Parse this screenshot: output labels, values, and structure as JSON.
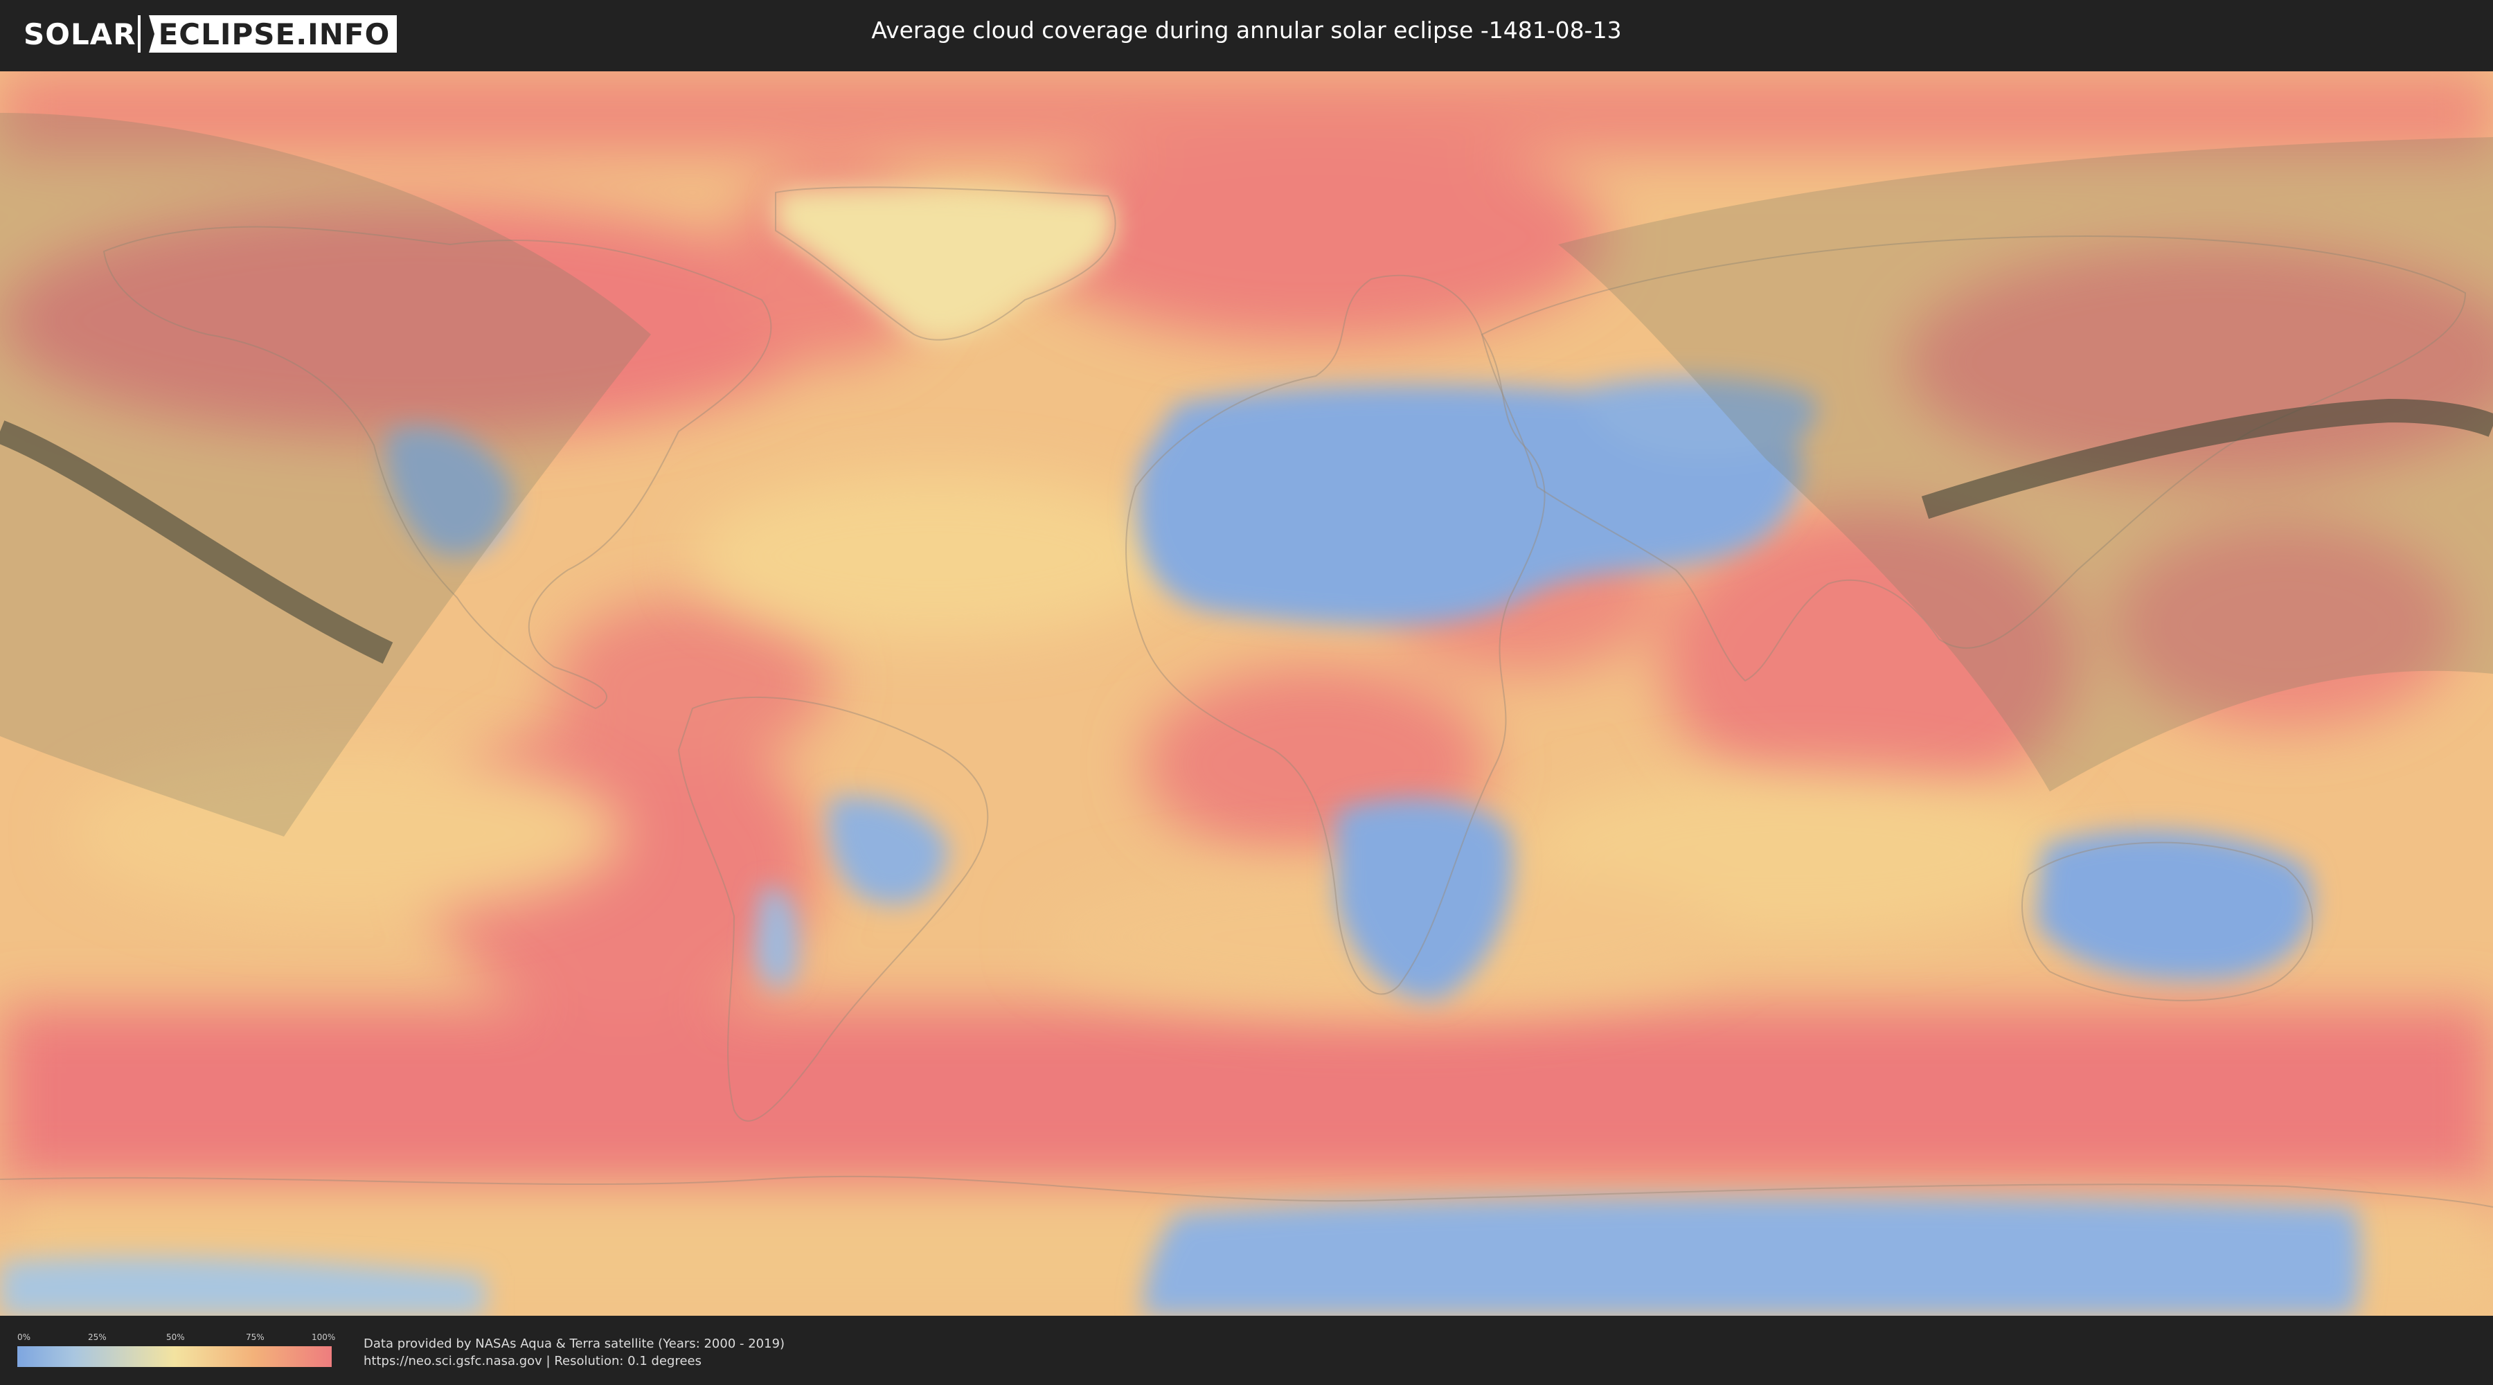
{
  "logo": {
    "part1": "SOLAR",
    "part2": "ECLIPSE.INFO"
  },
  "title": "Average cloud coverage during annular solar eclipse -1481-08-13",
  "legend": {
    "ticks": [
      "0%",
      "25%",
      "50%",
      "75%",
      "100%"
    ],
    "colors": {
      "low": "#7ea6e0",
      "mid": "#f3e3a0",
      "high": "#ee7d7e"
    }
  },
  "source": {
    "line1": "Data provided by NASAs Aqua & Terra satellite (Years: 2000 - 2019)",
    "line2": "https://neo.sci.gsfc.nasa.gov | Resolution: 0.1 degrees"
  },
  "colors": {
    "header_bg": "#222222",
    "cloudy": "#ee7d7e",
    "medium": "#f3c98a",
    "clear": "#7ea6e0",
    "eclipse_shade": "#8a8a6a",
    "central_path": "#4a4a38"
  }
}
